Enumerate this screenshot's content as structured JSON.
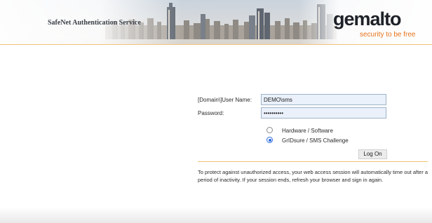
{
  "header": {
    "app_title": "SafeNet Authentication Service",
    "logo_text": "gemalto",
    "logo_tagline": "security to be free",
    "colors": {
      "accent_orange": "#e8731a",
      "divider": "#f0c173"
    }
  },
  "login": {
    "username_label": "[Domain\\]User Name:",
    "username_value": "DEMO\\sms",
    "password_label": "Password:",
    "password_value": "••••••••••",
    "auth_options": [
      {
        "label": "Hardware / Software",
        "selected": false
      },
      {
        "label": "GrIDsure / SMS Challenge",
        "selected": true
      }
    ],
    "logon_button_label": "Log On"
  },
  "notice": {
    "text": "To protect against unauthorized access, your web access session will automatically time out after a period of inactivity. If your session ends, refresh your browser and sign in again."
  }
}
